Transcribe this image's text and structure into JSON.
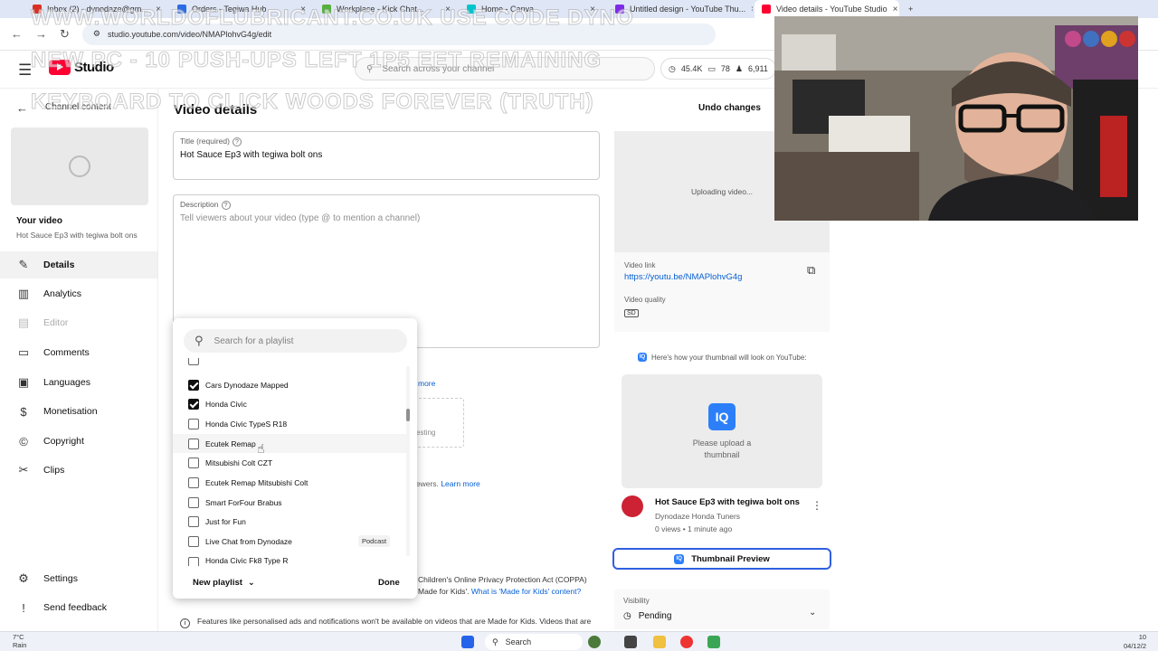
{
  "browser": {
    "tabs": [
      {
        "title": "Inbox (2) - dynodaze@gm..."
      },
      {
        "title": "Orders - Tegiwa Hub"
      },
      {
        "title": "Workplace - Kick Chat..."
      },
      {
        "title": "Home - Canva"
      },
      {
        "title": "Untitled design - YouTube Thu..."
      },
      {
        "title": "Video details - YouTube Studio"
      }
    ],
    "url": "studio.youtube.com/video/NMAPlohvG4g/edit"
  },
  "overlay_banner": [
    "WWW.WORLDOFLUBRICANT.CO.UK USE CODE DYNO",
    "NEW PC - 10 PUSH-UPS LEFT 1P5 EET REMAINING",
    "KEYBOARD TO CLICK WOODS FOREVER (TRUTH)"
  ],
  "header": {
    "logo_text": "Studio",
    "search_placeholder": "Search across your channel",
    "stats": {
      "views": "45.4K",
      "comments": "78",
      "subs": "6,911"
    }
  },
  "sidebar": {
    "back_label": "Channel content",
    "your_video_label": "Your video",
    "video_title": "Hot Sauce Ep3 with tegiwa bolt ons",
    "items": [
      {
        "label": "Details",
        "icon": "pencil-icon",
        "glyph": "✎"
      },
      {
        "label": "Analytics",
        "icon": "bar-chart-icon",
        "glyph": "▥"
      },
      {
        "label": "Editor",
        "icon": "film-icon",
        "glyph": "▤"
      },
      {
        "label": "Comments",
        "icon": "comment-icon",
        "glyph": "▭"
      },
      {
        "label": "Languages",
        "icon": "subtitles-icon",
        "glyph": "▣"
      },
      {
        "label": "Monetisation",
        "icon": "dollar-icon",
        "glyph": "$"
      },
      {
        "label": "Copyright",
        "icon": "copyright-icon",
        "glyph": "©"
      },
      {
        "label": "Clips",
        "icon": "scissors-icon",
        "glyph": "✂"
      }
    ],
    "settings_label": "Settings",
    "feedback_label": "Send feedback"
  },
  "main": {
    "page_title": "Video details",
    "undo_label": "Undo changes",
    "title_label": "Title (required)",
    "title_value": "Hot Sauce Ep3 with tegiwa bolt ons",
    "description_label": "Description",
    "description_placeholder": "Tell viewers about your video (type @ to mention a channel)",
    "more_link": "more",
    "thumb_slot_text": "esting",
    "learn_prefix": "iewers.",
    "learn_more": "Learn more",
    "coppa_line1": "Children's Online Privacy Protection Act (COPPA)",
    "coppa_line2_prefix": "Made for Kids'.",
    "coppa_link": "What is 'Made for Kids' content?",
    "features_note": "Features like personalised ads and notifications won't be available on videos that are Made for Kids. Videos that are"
  },
  "playlist": {
    "search_placeholder": "Search for a playlist",
    "items": [
      {
        "label": "Cars Dynodaze Mapped",
        "checked": true
      },
      {
        "label": "Honda Civic",
        "checked": true
      },
      {
        "label": "Honda Civic TypeS R18",
        "checked": false
      },
      {
        "label": "Ecutek Remap",
        "checked": false
      },
      {
        "label": "Mitsubishi Colt CZT",
        "checked": false
      },
      {
        "label": "Ecutek Remap Mitsubishi Colt",
        "checked": false
      },
      {
        "label": "Smart ForFour Brabus",
        "checked": false
      },
      {
        "label": "Just for Fun",
        "checked": false
      },
      {
        "label": "Live Chat from Dynodaze",
        "checked": false,
        "badge": "Podcast"
      },
      {
        "label": "Honda Civic Fk8 Type R",
        "checked": false
      }
    ],
    "new_playlist_label": "New playlist",
    "done_label": "Done"
  },
  "right": {
    "preview_text": "Uploading video...",
    "video_link_label": "Video link",
    "video_link": "https://youtu.be/NMAPlohvG4g",
    "video_quality_label": "Video quality",
    "quality_badge": "SD",
    "thumb_note": "Here's how your thumbnail will look on YouTube:",
    "upload_prompt_1": "Please upload a",
    "upload_prompt_2": "thumbnail",
    "card_title": "Hot Sauce Ep3 with tegiwa bolt ons",
    "card_channel": "Dynodaze Honda Tuners",
    "card_meta": "0 views • 1 minute ago",
    "thumb_preview_button": "Thumbnail Preview",
    "visibility_label": "Visibility",
    "visibility_value": "Pending"
  },
  "taskbar": {
    "temp": "7°C",
    "weather": "Rain",
    "search_label": "Search",
    "time": "10",
    "date": "04/12/2"
  }
}
